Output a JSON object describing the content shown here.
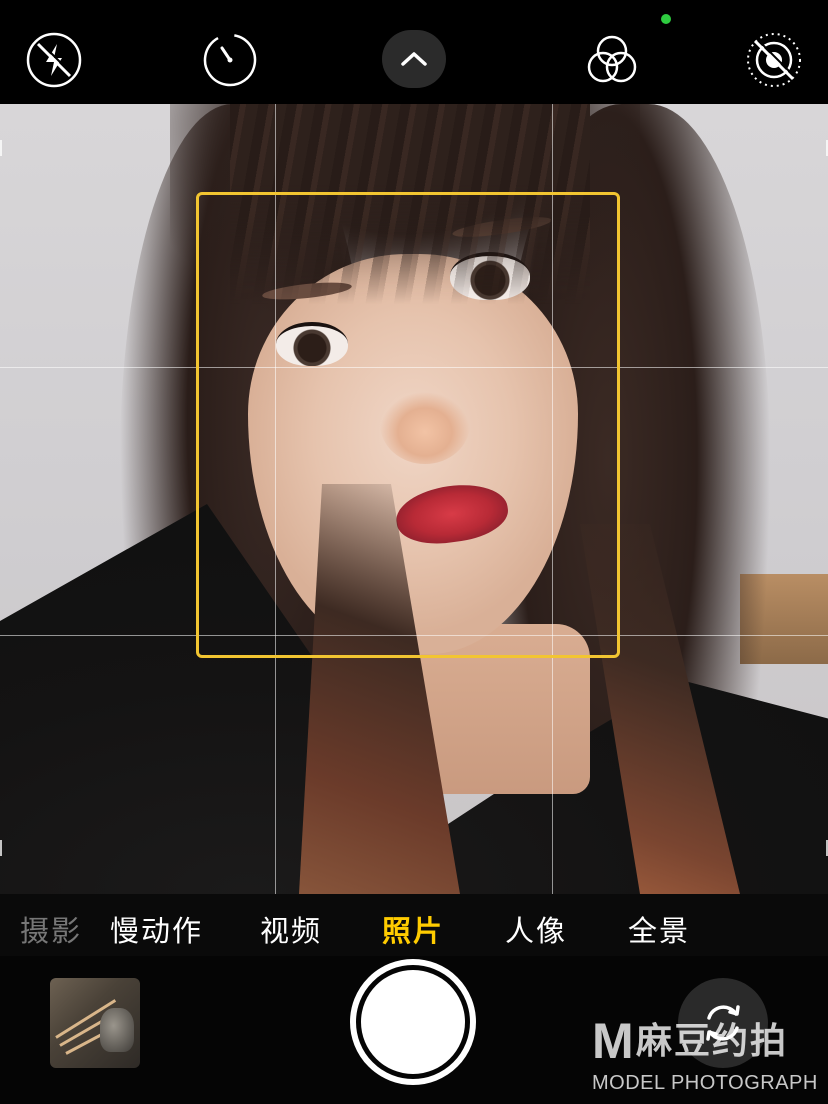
{
  "colors": {
    "accent_yellow": "#ffcc00",
    "focus_box": "#f2c531",
    "privacy_indicator": "#2ecc40",
    "top_bar_bg": "#000000",
    "mode_active": "#ffcc00"
  },
  "top_bar": {
    "icons": [
      "flash-off-icon",
      "timer-icon",
      "chevron-up-icon",
      "filters-icon",
      "live-photo-off-icon"
    ]
  },
  "modes": {
    "items": [
      {
        "label": "摄影",
        "state": "faded"
      },
      {
        "label": "慢动作",
        "state": "normal"
      },
      {
        "label": "视频",
        "state": "normal"
      },
      {
        "label": "照片",
        "state": "active"
      },
      {
        "label": "人像",
        "state": "normal"
      },
      {
        "label": "全景",
        "state": "normal"
      }
    ],
    "selected": "照片"
  },
  "bottom": {
    "shutter_icon": "shutter-button",
    "flip_icon": "camera-flip-icon",
    "thumbnail_icon": "last-photo-thumbnail"
  },
  "watermark": {
    "logo": "M",
    "brand_cn": "麻豆约拍",
    "brand_en": "MODEL PHOTOGRAPH"
  }
}
